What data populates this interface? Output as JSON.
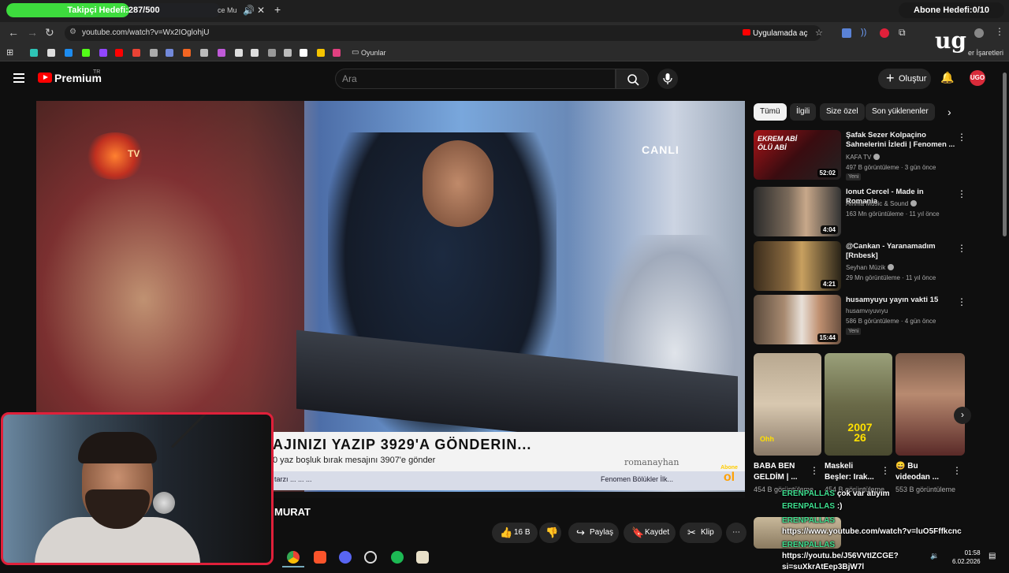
{
  "overlays": {
    "follower_goal": "Takipçi Hedefi:287/500",
    "follower_progress": 0.574,
    "subscriber_goal": "Abone Hedefi:0/10"
  },
  "browser": {
    "tab_title": "ce Mu",
    "url": "youtube.com/watch?v=Wx2IOglohjU",
    "open_in_app": "Uygulamada aç",
    "bookmark_folder": "Oyunlar",
    "bookmarks_right": "er İşaretleri"
  },
  "youtube": {
    "brand": "Premium",
    "brand_sup": "TR",
    "search_placeholder": "Ara",
    "create_label": "Oluştur",
    "avatar_text": "UGO"
  },
  "video": {
    "logo_text": "TV",
    "live_label": "CANLI",
    "ticker_main": "AJINIZI YAZIP 3929'A GÖNDERIN...",
    "ticker_sub": "0 yaz boşluk bırak mesajını 3907'e gönder",
    "ticker_channel": "romanayhan",
    "strip_left": "tarzı ... ... ...",
    "strip_right": "Fenomen Bölükler İlk...",
    "abone_label": "Abone",
    "abone_big": "ol",
    "title": "MURAT"
  },
  "actions": {
    "like_count": "16 B",
    "share": "Paylaş",
    "save": "Kaydet",
    "clip": "Klip"
  },
  "chips": [
    "Tümü",
    "İlgili",
    "Size özel",
    "Son yüklenenler"
  ],
  "recommendations": [
    {
      "title": "Şafak Sezer Kolpaçino Sahnelerini İzledi | Fenomen ...",
      "channel": "KAFA TV",
      "meta": "497 B görüntüleme · 3 gün önce",
      "badge": "Yeni",
      "duration": "52:02",
      "thumb_text": "EKREM ABİ ÖLÜ ABİ"
    },
    {
      "title": "Ionut Cercel - Made in Romania",
      "channel": "Amma Music & Sound",
      "meta": "163 Mn görüntüleme · 11 yıl önce",
      "badge": "",
      "duration": "4:04",
      "thumb_text": ""
    },
    {
      "title": "@Cankan - Yaranamadım [Rnbesk]",
      "channel": "Seyhan Müzik",
      "meta": "29 Mn görüntüleme · 11 yıl önce",
      "badge": "",
      "duration": "4:21",
      "thumb_text": ""
    },
    {
      "title": "husamyuyu yayın vakti 15",
      "channel": "husamvıyuvıyu",
      "meta": "586 B görüntüleme · 4 gün önce",
      "badge": "Yeni",
      "duration": "15:44",
      "thumb_text": ""
    }
  ],
  "shorts": [
    {
      "title": "BABA BEN GELDİM | ...",
      "views": "454 B görüntüleme",
      "thumb_text": "Ohh"
    },
    {
      "title": "Maskeli Beşler: Irak...",
      "views": "454 B görüntüleme",
      "thumb_text": "2007 26"
    },
    {
      "title": "😄 Bu videodan ...",
      "views": "553 B görüntüleme",
      "thumb_text": ""
    }
  ],
  "chat": [
    {
      "user": "ERENPALLAS",
      "msg": "çok var atıyım"
    },
    {
      "user": "ERENPALLAS",
      "msg": ":)"
    },
    {
      "user": "ERENPALLAS",
      "msg": "https://www.youtube.com/watch?v=luO5Fffkcnc"
    },
    {
      "user": "ERENPALLAS",
      "msg": "https://youtu.be/J56VVtIZCGE?si=suXkrAtEep3BjW7l"
    }
  ],
  "clock": {
    "time": "01:58",
    "date": "6.02.2026"
  },
  "colors": {
    "accent_red": "#ff0000",
    "progress_green": "#3ddc3d",
    "webcam_border": "#e0203a",
    "chat_user": "#3edf8f"
  }
}
